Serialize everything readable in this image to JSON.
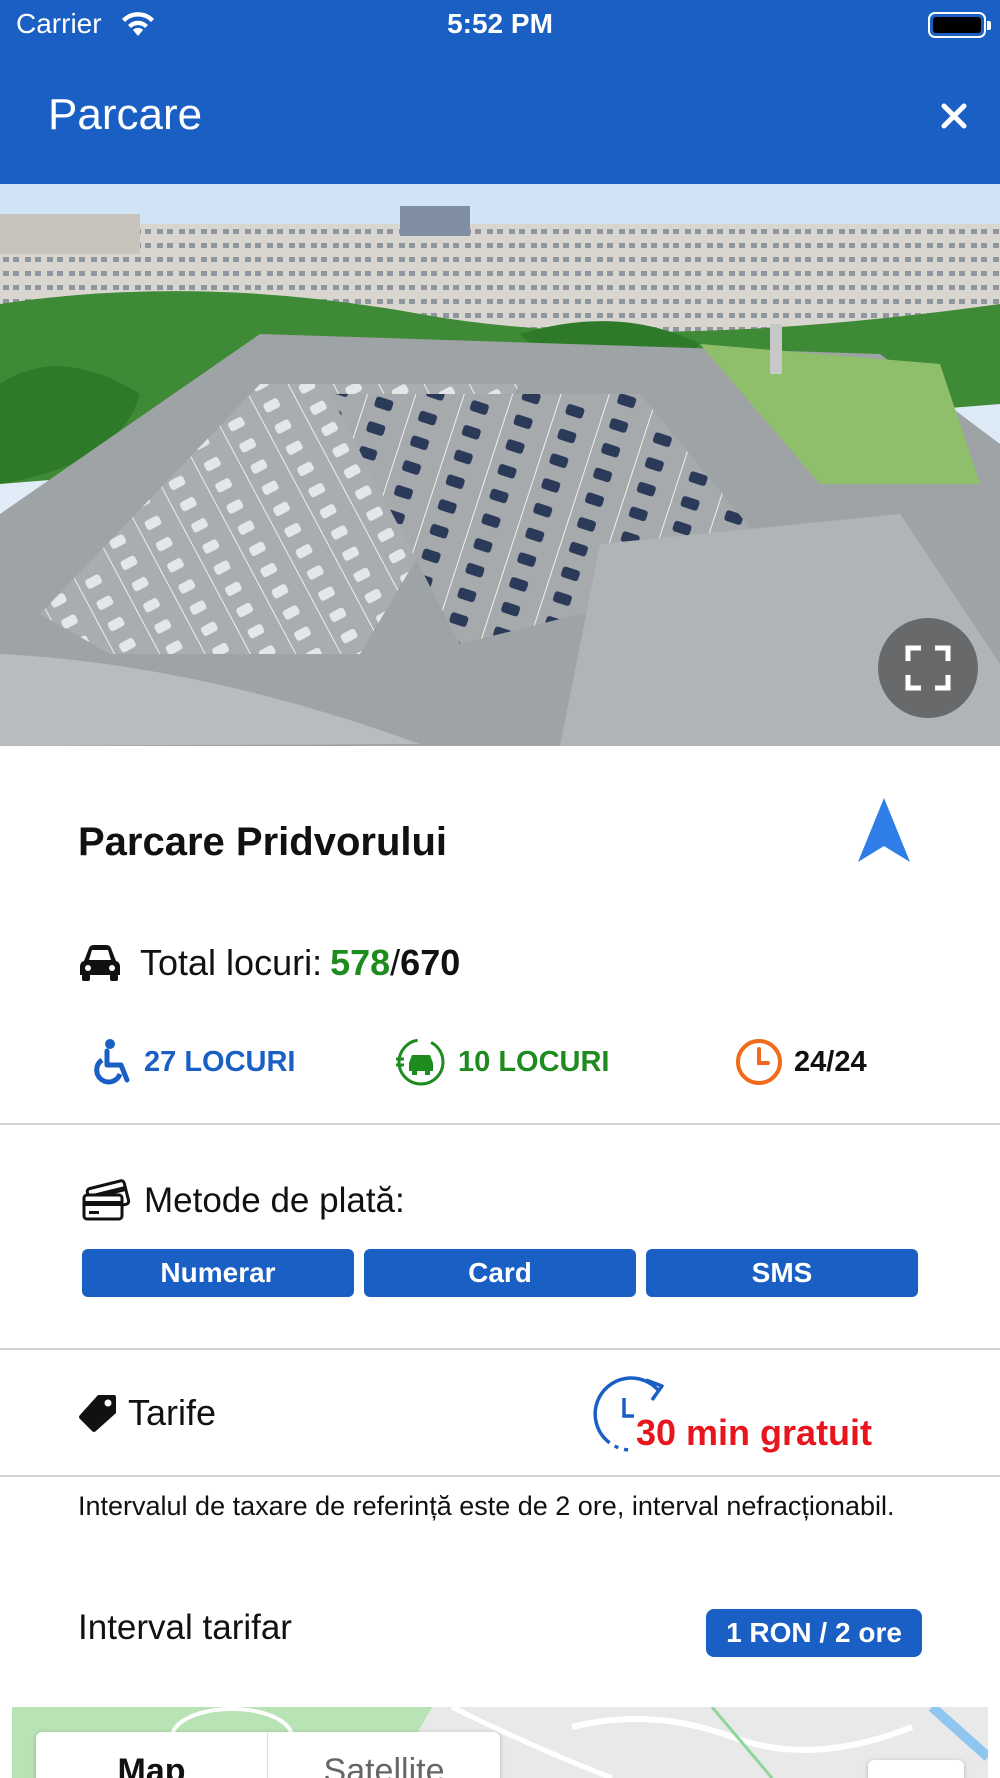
{
  "status_bar": {
    "carrier": "Carrier",
    "time": "5:52 PM"
  },
  "header": {
    "title": "Parcare",
    "close_icon": "close-icon"
  },
  "hero": {
    "image": "aerial photo of parking lot with apartment blocks",
    "expand_icon": "fullscreen-icon"
  },
  "parking": {
    "name": "Parcare Pridvorului",
    "navigation_icon": "navigation-arrow-icon",
    "total_label": "Total locuri:",
    "free_spots": "578",
    "separator": "/",
    "total_spots": "670"
  },
  "features": [
    {
      "icon": "wheelchair-icon",
      "label": "27 LOCURI"
    },
    {
      "icon": "ev-charging-icon",
      "label": "10 LOCURI"
    },
    {
      "icon": "clock-icon",
      "label": "24/24"
    }
  ],
  "payment": {
    "title": "Metode de plată:",
    "methods": [
      "Numerar",
      "Card",
      "SMS"
    ]
  },
  "tariffs": {
    "title": "Tarife",
    "free_time": "30 min gratuit",
    "description": "Intervalul de taxare de referință este de 2 ore, interval nefracționabil.",
    "interval_label": "Interval tarifar",
    "price": "1 RON / 2 ore"
  },
  "map": {
    "tabs": [
      "Map",
      "Satellite"
    ]
  },
  "colors": {
    "primary": "#1a5fc3",
    "free_green": "#1e8b1e",
    "accent_red": "#e8151c",
    "clock_orange": "#f26a1b"
  }
}
